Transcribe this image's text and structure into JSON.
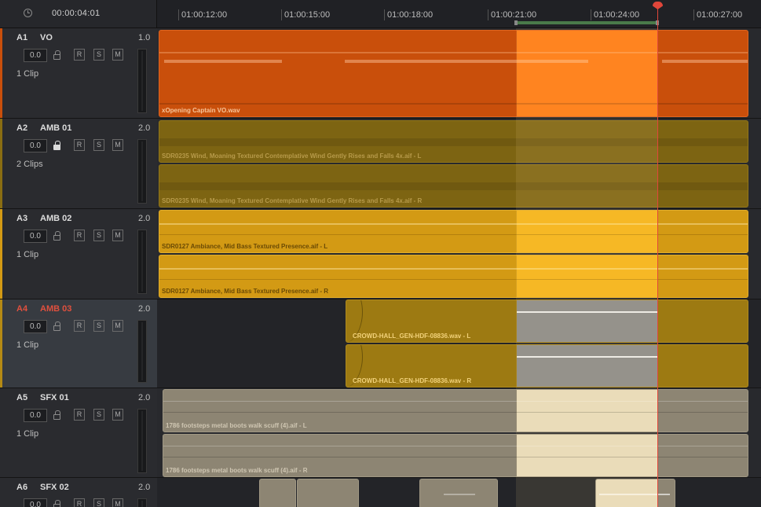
{
  "header": {
    "timecode": "00:00:04:01",
    "clock_icon": "clock-icon"
  },
  "ruler": {
    "ticks": [
      "01:00:12:00",
      "01:00:15:00",
      "01:00:18:00",
      "01:00:21:00",
      "01:00:24:00",
      "01:00:27:00"
    ]
  },
  "colors": {
    "vo_clip": "#c94f0b",
    "vo_highlight": "#ff7a12",
    "amb01_clip": "#7d6412",
    "amb02_clip": "#d39a14",
    "amb02_highlight": "#f5b418",
    "amb03_clip": "#9d7a12",
    "sfx_clip": "#8d8573",
    "sfx_highlight": "#e8dcbd",
    "playhead": "#e0463a",
    "selected_track_text": "#e0503e"
  },
  "tracks": [
    {
      "id": "A1",
      "name": "VO",
      "channels": "1.0",
      "volume": "0.0",
      "clips_label": "1 Clip",
      "lock_on": false,
      "clips": [
        "xOpening Captain VO.wav"
      ]
    },
    {
      "id": "A2",
      "name": "AMB 01",
      "channels": "2.0",
      "volume": "0.0",
      "clips_label": "2 Clips",
      "lock_on": true,
      "clips": [
        "SDR0235 Wind, Moaning Textured Contemplative Wind Gently Rises and Falls 4x.aif - L",
        "SDR0235 Wind, Moaning Textured Contemplative Wind Gently Rises and Falls 4x.aif - R"
      ]
    },
    {
      "id": "A3",
      "name": "AMB 02",
      "channels": "2.0",
      "volume": "0.0",
      "clips_label": "1 Clip",
      "lock_on": false,
      "clips": [
        "SDR0127 Ambiance, Mid Bass Textured Presence.aif - L",
        "SDR0127 Ambiance, Mid Bass Textured Presence.aif - R"
      ]
    },
    {
      "id": "A4",
      "name": "AMB 03",
      "channels": "2.0",
      "volume": "0.0",
      "clips_label": "1 Clip",
      "lock_on": false,
      "clips": [
        "CROWD-HALL_GEN-HDF-08836.wav - L",
        "CROWD-HALL_GEN-HDF-08836.wav - R"
      ]
    },
    {
      "id": "A5",
      "name": "SFX 01",
      "channels": "2.0",
      "volume": "0.0",
      "clips_label": "1 Clip",
      "lock_on": false,
      "clips": [
        "1786 footsteps metal boots walk scuff (4).aif - L",
        "1786 footsteps metal boots walk scuff (4).aif - R"
      ]
    },
    {
      "id": "A6",
      "name": "SFX 02",
      "channels": "2.0",
      "volume": "0.0",
      "clips_label": "",
      "lock_on": false,
      "clips": []
    }
  ],
  "buttons": {
    "record": "R",
    "solo": "S",
    "mute": "M"
  }
}
